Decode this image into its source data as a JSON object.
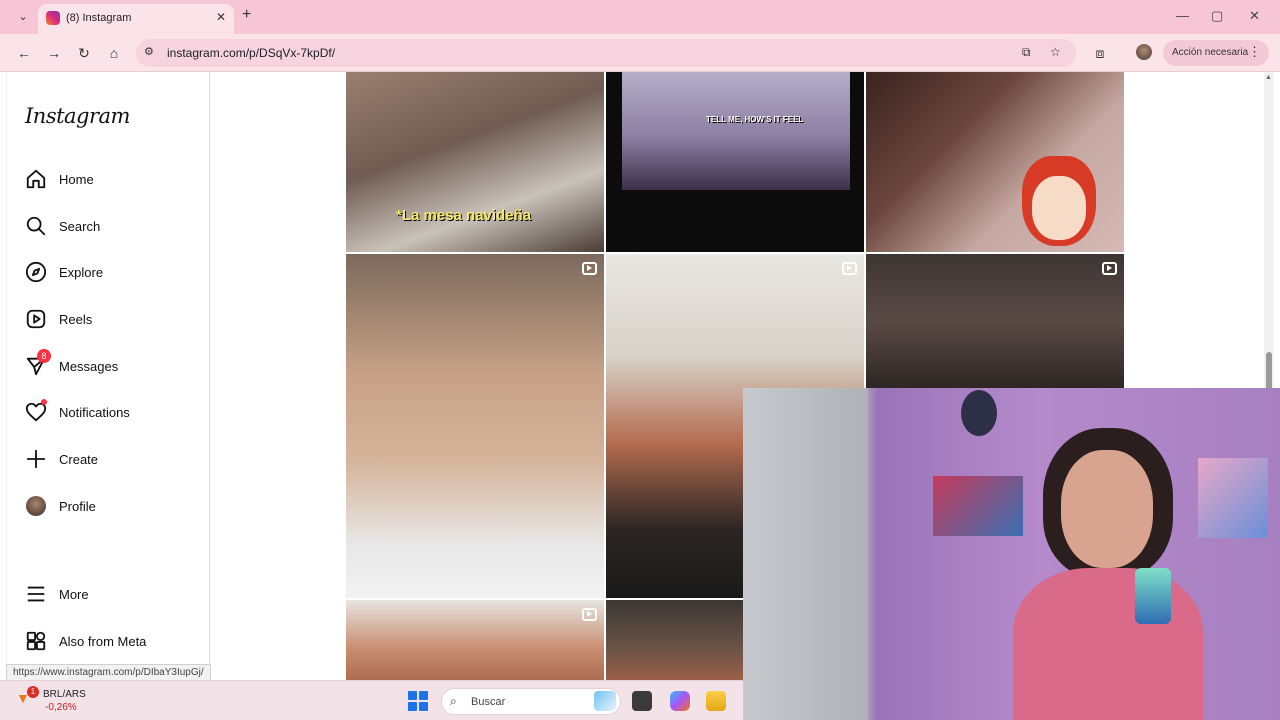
{
  "browser": {
    "tab_title": "(8) Instagram",
    "tab_close": "✕",
    "tab_list": "⌄",
    "new_tab": "+",
    "url": "instagram.com/p/DSqVx-7kpDf/",
    "action_label": "Acción necesaria",
    "menu_glyph": "⋮",
    "win_minimize": "—",
    "win_maximize": "▢",
    "win_close": "✕",
    "status_url": "https://www.instagram.com/p/DIbaY3IupGj/"
  },
  "sidebar": {
    "logo": "Instagram",
    "items": [
      {
        "label": "Home",
        "icon": "home-icon"
      },
      {
        "label": "Search",
        "icon": "search-icon"
      },
      {
        "label": "Explore",
        "icon": "compass-icon"
      },
      {
        "label": "Reels",
        "icon": "reels-icon"
      },
      {
        "label": "Messages",
        "icon": "messenger-icon",
        "badge": "8"
      },
      {
        "label": "Notifications",
        "icon": "heart-icon"
      },
      {
        "label": "Create",
        "icon": "plus-icon"
      },
      {
        "label": "Profile",
        "icon": "avatar"
      },
      {
        "label": "More",
        "icon": "menu-icon"
      },
      {
        "label": "Also from Meta",
        "icon": "meta-apps-icon"
      }
    ]
  },
  "grid": {
    "tile1_caption": "*La mesa navideña",
    "tile2_caption": "TELL ME, HOW'S IT FEEL"
  },
  "taskbar": {
    "ticker_badge": "1",
    "ticker_name": "BRL/ARS",
    "ticker_change": "-0,26%",
    "search_placeholder": "Buscar"
  },
  "colors": {
    "tab_strip": "#f7c6d6",
    "toolbar": "#fbe3ea",
    "notification_red": "#ff3040"
  }
}
